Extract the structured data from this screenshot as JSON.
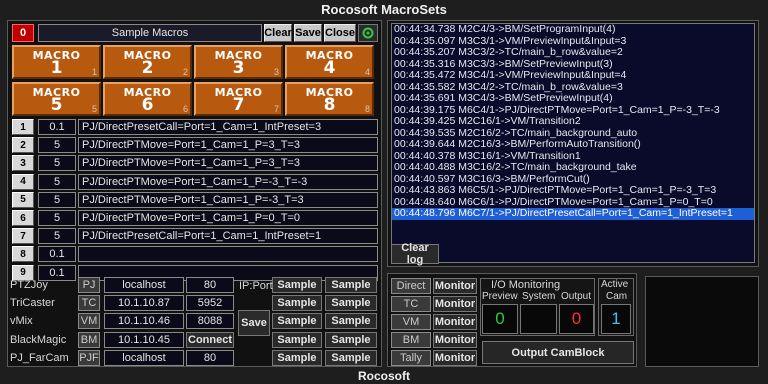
{
  "app": {
    "title": "Rocosoft MacroSets",
    "footer": "Rocosoft"
  },
  "header": {
    "counter": "0",
    "macro_name": "Sample Macros",
    "clear_label": "Clear",
    "save_label": "Save",
    "close_label": "Close"
  },
  "macros": [
    {
      "label": "MACRO",
      "number": "1",
      "index": "1"
    },
    {
      "label": "MACRO",
      "number": "2",
      "index": "2"
    },
    {
      "label": "MACRO",
      "number": "3",
      "index": "3"
    },
    {
      "label": "MACRO",
      "number": "4",
      "index": "4"
    },
    {
      "label": "MACRO",
      "number": "5",
      "index": "5"
    },
    {
      "label": "MACRO",
      "number": "6",
      "index": "6"
    },
    {
      "label": "MACRO",
      "number": "7",
      "index": "7"
    },
    {
      "label": "MACRO",
      "number": "8",
      "index": "8"
    }
  ],
  "steps": [
    {
      "num": "1",
      "delay": "0.1",
      "command": "PJ/DirectPresetCall=Port=1_Cam=1_IntPreset=3"
    },
    {
      "num": "2",
      "delay": "5",
      "command": "PJ/DirectPTMove=Port=1_Cam=1_P=3_T=3"
    },
    {
      "num": "3",
      "delay": "5",
      "command": "PJ/DirectPTMove=Port=1_Cam=1_P=3_T=3"
    },
    {
      "num": "4",
      "delay": "5",
      "command": "PJ/DirectPTMove=Port=1_Cam=1_P=-3_T=-3"
    },
    {
      "num": "5",
      "delay": "5",
      "command": "PJ/DirectPTMove=Port=1_Cam=1_P=-3_T=3"
    },
    {
      "num": "6",
      "delay": "5",
      "command": "PJ/DirectPTMove=Port=1_Cam=1_P=0_T=0"
    },
    {
      "num": "7",
      "delay": "5",
      "command": "PJ/DirectPresetCall=Port=1_Cam=1_IntPreset=1"
    },
    {
      "num": "8",
      "delay": "0.1",
      "command": ""
    },
    {
      "num": "9",
      "delay": "0.1",
      "command": ""
    }
  ],
  "devices": [
    {
      "name": "PTZJoy",
      "code": "PJ",
      "host": "localhost",
      "port": "80"
    },
    {
      "name": "TriCaster",
      "code": "TC",
      "host": "10.1.10.87",
      "port": "5952"
    },
    {
      "name": "vMix",
      "code": "VM",
      "host": "10.1.10.46",
      "port": "8088"
    },
    {
      "name": "BlackMagic",
      "code": "BM",
      "host": "10.1.10.45",
      "port": "Connect"
    },
    {
      "name": "PJ_FarCam",
      "code": "PJF",
      "host": "localhost",
      "port": "80"
    }
  ],
  "ipport_label": "IP:Port",
  "save_label": "Save",
  "sample_label": "Sample",
  "log": {
    "lines": [
      "00:44:34.738 M2C4/3->BM/SetProgramInput(4)",
      "00:44:35.097 M3C3/1->VM/PreviewInput&Input=3",
      "00:44:35.207 M3C3/2->TC/main_b_row&value=2",
      "00:44:35.316 M3C3/3->BM/SetPreviewInput(3)",
      "00:44:35.472 M3C4/1->VM/PreviewInput&Input=4",
      "00:44:35.582 M3C4/2->TC/main_b_row&value=3",
      "00:44:35.691 M3C4/3->BM/SetPreviewInput(4)",
      "00:44:39.175 M6C4/1->PJ/DirectPTMove=Port=1_Cam=1_P=-3_T=-3",
      "00:44:39.425 M2C16/1->VM/Transition2",
      "00:44:39.535 M2C16/2->TC/main_background_auto",
      "00:44:39.644 M2C16/3->BM/PerformAutoTransition()",
      "00:44:40.378 M3C16/1->VM/Transition1",
      "00:44:40.488 M3C16/2->TC/main_background_take",
      "00:44:40.597 M3C16/3->BM/PerformCut()",
      "00:44:43.863 M6C5/1->PJ/DirectPTMove=Port=1_Cam=1_P=-3_T=3",
      "00:44:48.640 M6C6/1->PJ/DirectPTMove=Port=1_Cam=1_P=0_T=0",
      "00:44:48.796 M6C7/1->PJ/DirectPresetCall=Port=1_Cam=1_IntPreset=1"
    ],
    "clear_label": "Clear log"
  },
  "monitor": {
    "devices": [
      "Direct",
      "TC",
      "VM",
      "BM",
      "Tally"
    ],
    "button_label": "Monitor",
    "io_title": "I/O Monitoring",
    "preview_label": "Preview",
    "system_label": "System",
    "output_label": "Output",
    "preview_value": "0",
    "system_value": "",
    "output_value": "0",
    "active_label_1": "Active",
    "active_label_2": "Cam",
    "active_value": "1",
    "output_block_label": "Output CamBlock"
  },
  "colors": {
    "accent_orange": "#b75a10",
    "preview_green": "#2ecc40",
    "output_red": "#ff3030",
    "active_cyan": "#40c0ff",
    "log_selected": "#1f5fd6"
  }
}
